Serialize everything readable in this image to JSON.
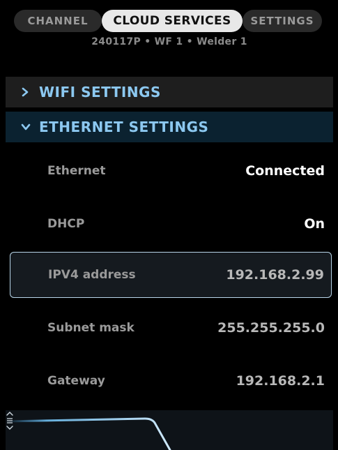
{
  "tabs": [
    {
      "label": "CHANNEL",
      "active": false
    },
    {
      "label": "CLOUD SERVICES",
      "active": true
    },
    {
      "label": "SETTINGS",
      "active": false
    }
  ],
  "breadcrumb": "240117P  •  WF 1  •  Welder 1",
  "sections": {
    "wifi": {
      "title": "WIFI SETTINGS",
      "expanded": false
    },
    "ethernet": {
      "title": "ETHERNET SETTINGS",
      "expanded": true
    }
  },
  "rows": [
    {
      "label": "Ethernet",
      "value": "Connected"
    },
    {
      "label": "DHCP",
      "value": "On"
    },
    {
      "label": "IPV4 address",
      "value": "192.168.2.99",
      "selected": true
    },
    {
      "label": "Subnet mask",
      "value": "255.255.255.0"
    },
    {
      "label": "Gateway",
      "value": "192.168.2.1"
    }
  ],
  "icons": {
    "wifi_chevron": "chevron-right-icon",
    "ethernet_chevron": "chevron-down-icon",
    "scroll": "scroll-updown-icon"
  },
  "colors": {
    "accent": "#8cc8f0",
    "selected_border": "#b9d6ea",
    "tab_active_bg": "#e8e8e8"
  }
}
